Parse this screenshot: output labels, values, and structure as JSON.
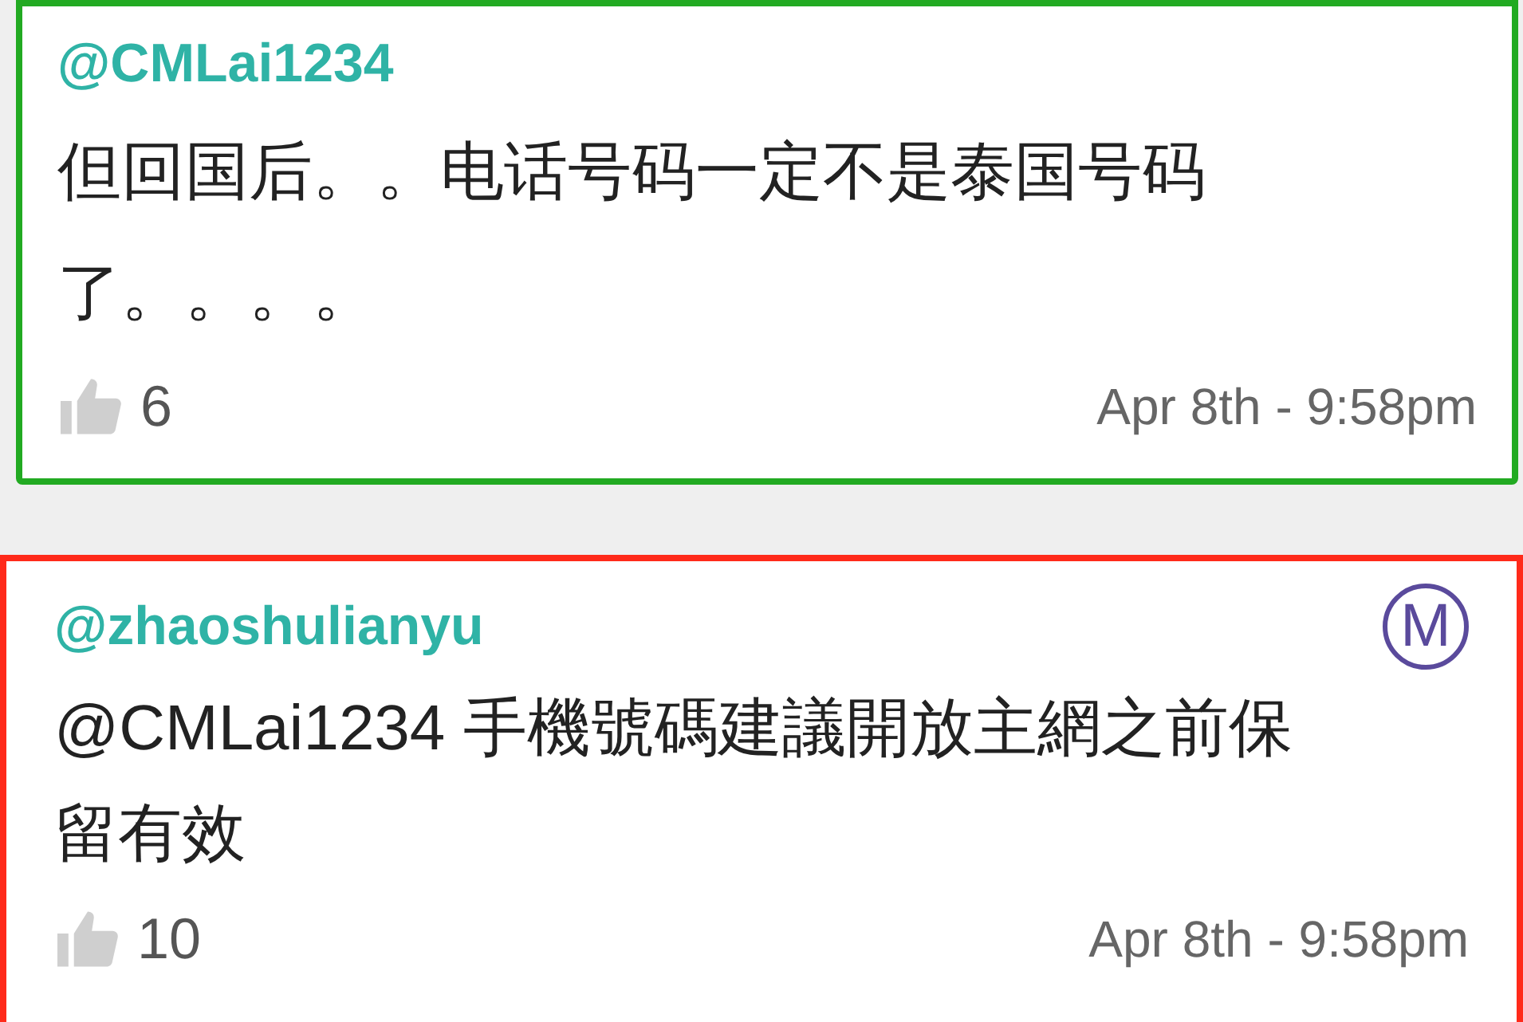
{
  "comments": [
    {
      "author": "@CMLai1234",
      "color": "#22aa22",
      "text": "但回国后。。电话号码一定不是泰国号码了。。。。",
      "likes": "6",
      "time": "Apr 8th - 9:58pm"
    },
    {
      "author": "@zhaoshulianyu",
      "color": "#ff2a1a",
      "badge": "M",
      "text": "@CMLai1234 手機號碼建議開放主網之前保留有效",
      "likes": "10",
      "time": "Apr 8th - 9:58pm"
    }
  ]
}
